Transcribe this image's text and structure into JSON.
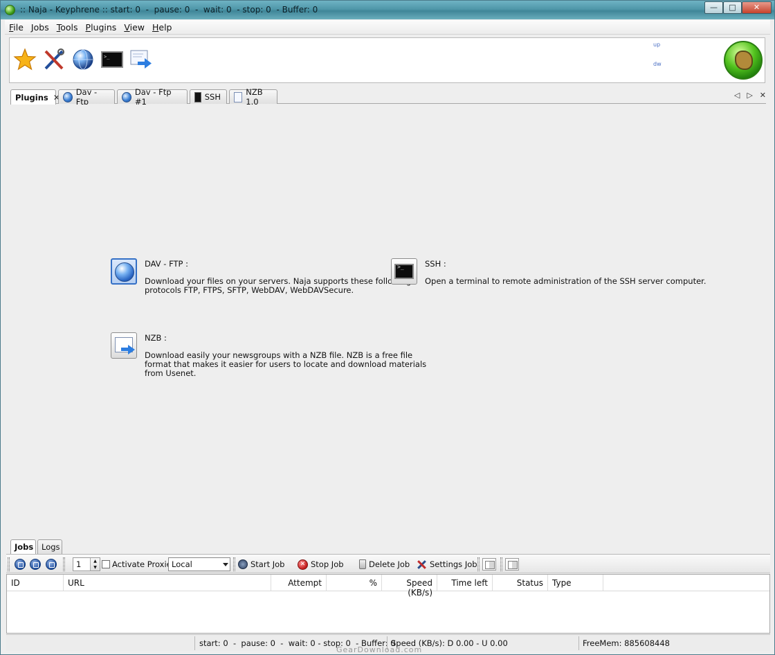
{
  "window": {
    "title": ":: Naja - Keyphrene :: start: 0  -  pause: 0  -  wait: 0  - stop: 0  - Buffer: 0",
    "controls": {
      "minimize": "—",
      "maximize": "□",
      "close": "✕"
    }
  },
  "menu": {
    "items": [
      {
        "label": "ile",
        "mnemonic": "F"
      },
      {
        "label": "obs",
        "mnemonic": "J"
      },
      {
        "label": "ools",
        "mnemonic": "T"
      },
      {
        "label": "lugins",
        "mnemonic": "P"
      },
      {
        "label": "iew",
        "mnemonic": "V"
      },
      {
        "label": "elp",
        "mnemonic": "H"
      }
    ]
  },
  "toolbar": {
    "icons": [
      "star-icon",
      "tools-icon",
      "globe-icon",
      "terminal-icon",
      "nzb-download-icon"
    ],
    "graph_up_label": "up",
    "graph_down_label": "dw"
  },
  "tabs": [
    {
      "label": "Plugins",
      "active": true,
      "closable": true,
      "icon": null
    },
    {
      "label": "Dav - Ftp",
      "active": false,
      "icon": "globe-icon"
    },
    {
      "label": "Dav - Ftp #1",
      "active": false,
      "icon": "globe-icon"
    },
    {
      "label": "SSH",
      "active": false,
      "icon": "terminal-icon"
    },
    {
      "label": "NZB 1.0",
      "active": false,
      "icon": "nzb-icon"
    }
  ],
  "tab_nav": {
    "prev": "◁",
    "next": "▷",
    "close": "✕"
  },
  "plugins": [
    {
      "title": "DAV - FTP :",
      "description": "Download your files on your servers. Naja supports these following\nprotocols FTP, FTPS, SFTP, WebDAV, WebDAVSecure."
    },
    {
      "title": "SSH :",
      "description": "Open a terminal to remote administration of the SSH server computer."
    },
    {
      "title": "NZB :",
      "description": "Download easily your newsgroups with a NZB file. NZB is a free file\nformat that makes it easier for users to locate and download materials\nfrom Usenet."
    }
  ],
  "bottom_tabs": [
    {
      "label": "Jobs",
      "active": true
    },
    {
      "label": "Logs",
      "active": false
    }
  ],
  "jobbar": {
    "spinner_value": "1",
    "activate_proxies_label": "Activate Proxies",
    "activate_proxies_checked": false,
    "proxy_select": "Local",
    "start_job": "Start Job",
    "stop_job": "Stop Job",
    "delete_job": "Delete Job",
    "settings_job": "Settings Job"
  },
  "jobs_table": {
    "columns": [
      "ID",
      "URL",
      "Attempt",
      "%",
      "Speed (KB/s)",
      "Time left",
      "Status",
      "Type"
    ],
    "rows": []
  },
  "statusbar": {
    "counts": "start: 0  -  pause: 0  -  wait: 0 - stop: 0  - Buffer: 0",
    "speed": "Speed (KB/s): D 0.00 - U 0.00",
    "freemem": "FreeMem: 885608448"
  },
  "watermark": "GearDownload.com"
}
